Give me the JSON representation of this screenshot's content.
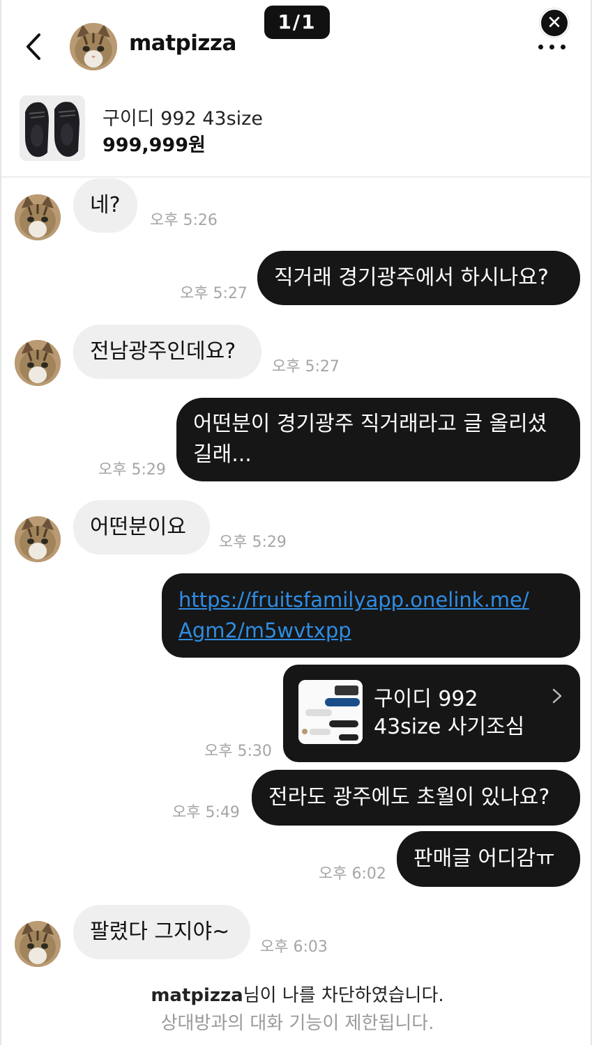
{
  "header": {
    "username": "matpizza",
    "counter": "1/1",
    "close_glyph": "✕"
  },
  "product": {
    "title": "구이디 992 43size",
    "price": "999,999원"
  },
  "messages": [
    {
      "side": "in",
      "text": "네?",
      "time": "오후 5:26"
    },
    {
      "side": "out",
      "text": "직거래 경기광주에서 하시나요?",
      "time": "오후 5:27"
    },
    {
      "side": "in",
      "text": "전남광주인데요?",
      "time": "오후 5:27"
    },
    {
      "side": "out",
      "line1": "어떤분이 경기광주 직거래라고 글 올리셨",
      "line2": "길래...",
      "time": "오후 5:29"
    },
    {
      "side": "in",
      "text": "어떤분이요",
      "time": "오후 5:29"
    },
    {
      "side": "out",
      "line1": "https://fruitsfamilyapp.onelink.me/",
      "line2": "Agm2/m5wvtxpp"
    },
    {
      "side": "out",
      "line1": "구이디 992",
      "line2": "43size 사기조심",
      "time": "오후 5:30"
    },
    {
      "side": "out",
      "text": "전라도 광주에도 초월이 있나요?",
      "time": "오후 5:49"
    },
    {
      "side": "out",
      "text": "판매글 어디감ㅠ",
      "time": "오후 6:02"
    },
    {
      "side": "in",
      "text": "팔렸다 그지야~",
      "time": "오후 6:03"
    }
  ],
  "blocked_notice": {
    "username": "matpizza",
    "line1_suffix": "님이 나를 차단하였습니다.",
    "line2": "상대방과의 대화 기능이 제한됩니다."
  }
}
